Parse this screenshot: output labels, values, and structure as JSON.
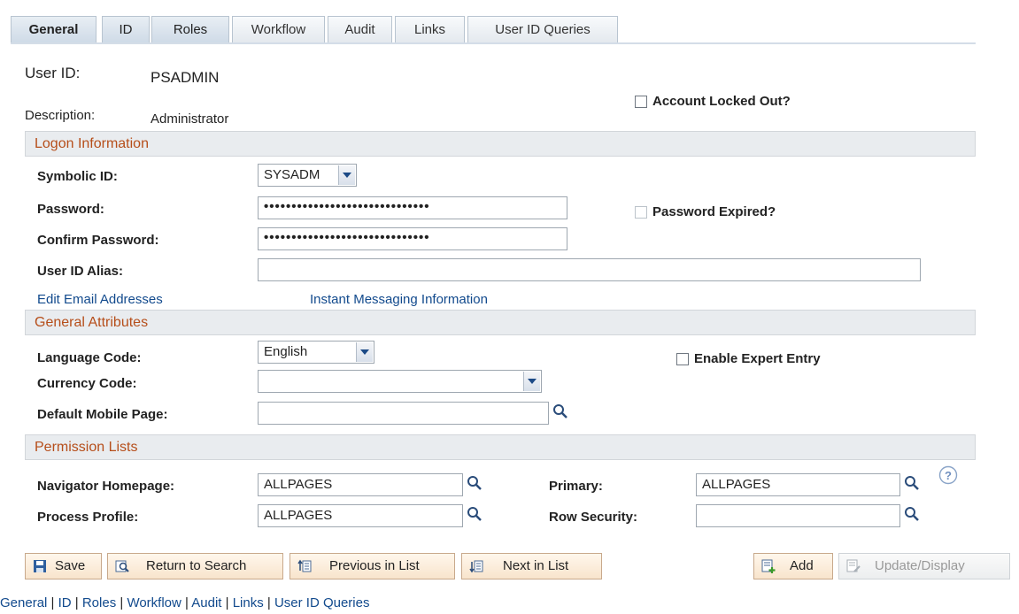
{
  "tabs": [
    "General",
    "ID",
    "Roles",
    "Workflow",
    "Audit",
    "Links",
    "User ID Queries"
  ],
  "user": {
    "id_label": "User ID:",
    "id_value": "PSADMIN",
    "desc_label": "Description:",
    "desc_value": "Administrator"
  },
  "account_locked": {
    "label": "Account Locked Out?",
    "checked": false
  },
  "sections": {
    "logon": "Logon Information",
    "general": "General Attributes",
    "permission": "Permission Lists"
  },
  "logon": {
    "symbolic_label": "Symbolic ID:",
    "symbolic_value": "SYSADM",
    "password_label": "Password:",
    "password_value": "••••••••••••••••••••••••••••••",
    "confirm_label": "Confirm Password:",
    "confirm_value": "••••••••••••••••••••••••••••••",
    "alias_label": "User ID Alias:",
    "alias_value": "",
    "password_expired": "Password Expired?"
  },
  "links": {
    "email": "Edit Email Addresses",
    "im": "Instant Messaging Information"
  },
  "general": {
    "language_label": "Language Code:",
    "language_value": "English",
    "currency_label": "Currency Code:",
    "currency_value": "",
    "mobile_label": "Default Mobile Page:",
    "mobile_value": "",
    "expert_entry": "Enable Expert Entry"
  },
  "permission": {
    "nav_label": "Navigator Homepage:",
    "nav_value": "ALLPAGES",
    "process_label": "Process Profile:",
    "process_value": "ALLPAGES",
    "primary_label": "Primary:",
    "primary_value": "ALLPAGES",
    "row_label": "Row Security:",
    "row_value": ""
  },
  "toolbar": {
    "save": "Save",
    "return": "Return to Search",
    "prev": "Previous in List",
    "next": "Next in List",
    "add": "Add",
    "update": "Update/Display"
  },
  "bottom_nav": [
    "General",
    "ID",
    "Roles",
    "Workflow",
    "Audit",
    "Links",
    "User ID Queries"
  ]
}
